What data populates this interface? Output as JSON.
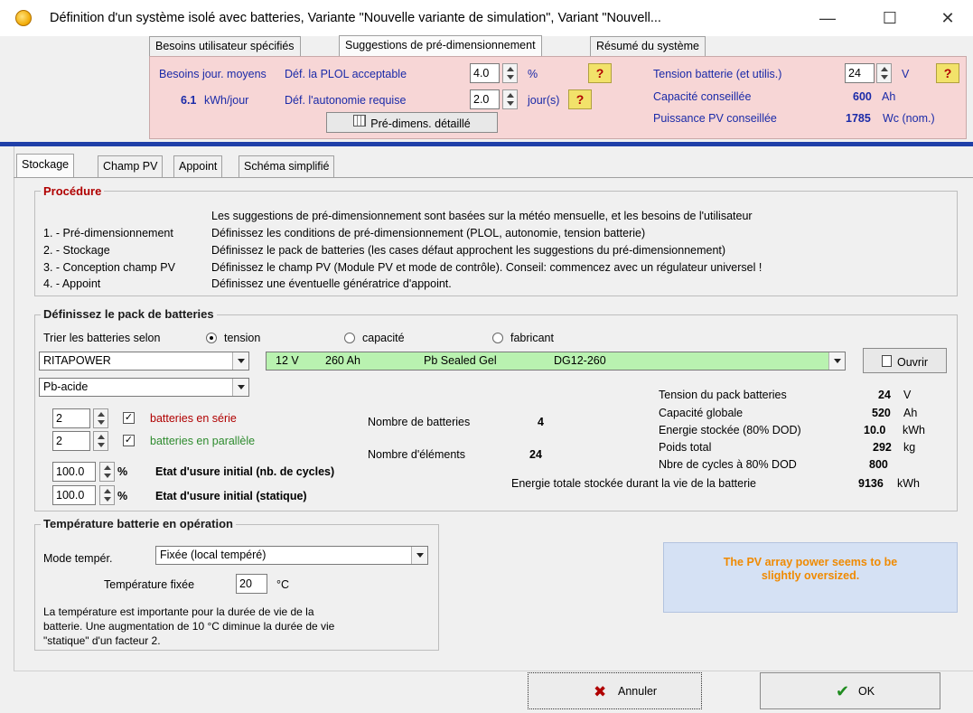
{
  "window": {
    "title": "Définition d'un système isolé avec batteries, Variante  \"Nouvelle variante de simulation\", Variant  \"Nouvell...",
    "minimize": "—",
    "maximize": "☐",
    "close": "✕"
  },
  "top_tabs": [
    "Besoins utilisateur spécifiés",
    "Suggestions de pré-dimensionnement",
    "Résumé du système"
  ],
  "presizing": {
    "needs_label": "Besoins jour. moyens",
    "needs_value": "6.1",
    "needs_unit": "kWh/jour",
    "plol_label": "Déf. la PLOL acceptable",
    "plol_value": "4.0",
    "plol_unit": "%",
    "autonomy_label": "Déf. l'autonomie requise",
    "autonomy_value": "2.0",
    "autonomy_unit": "jour(s)",
    "help": "?",
    "detail_button": "Pré-dimens. détaillé",
    "voltage_label": "Tension batterie (et utilis.)",
    "voltage_value": "24",
    "voltage_unit": "V",
    "capacity_label": "Capacité conseillée",
    "capacity_value": "600",
    "capacity_unit": "Ah",
    "pv_label": "Puissance PV conseillée",
    "pv_value": "1785",
    "pv_unit": "Wc (nom.)"
  },
  "sub_tabs": [
    "Stockage",
    "Champ PV",
    "Appoint",
    "Schéma simplifié"
  ],
  "procedure": {
    "title": "Procédure",
    "intro": "Les suggestions de pré-dimensionnement sont basées sur la météo mensuelle, et les besoins de l'utilisateur",
    "steps": [
      {
        "label": "1. - Pré-dimensionnement",
        "text": "Définissez les conditions de pré-dimensionnement  (PLOL, autonomie, tension batterie)"
      },
      {
        "label": "2. - Stockage",
        "text": "Définissez le pack de batteries  (les cases défaut approchent les suggestions du  pré-dimensionnement)"
      },
      {
        "label": "3. - Conception champ PV",
        "text": "Définissez le champ PV  (Module PV et mode de contrôle).  Conseil: commencez avec un régulateur universel !"
      },
      {
        "label": "4. - Appoint",
        "text": "Définissez une éventuelle génératrice d'appoint."
      }
    ]
  },
  "battery_pack": {
    "title": "Définissez le pack de batteries",
    "sort_label": "Trier les batteries selon",
    "sort_options": [
      "tension",
      "capacité",
      "fabricant"
    ],
    "manufacturer": "RITAPOWER",
    "battery_model": {
      "voltage": "12 V",
      "capacity": "260 Ah",
      "tech": "Pb  Sealed  Gel",
      "model": "DG12-260"
    },
    "open_button": "Ouvrir",
    "technology": "Pb-acide",
    "series_count": "2",
    "series_label": "batteries en série",
    "parallel_count": "2",
    "parallel_label": "batteries en parallèle",
    "wear_cycles_value": "100.0",
    "wear_cycles_label": "Etat d'usure initial (nb. de cycles)",
    "wear_static_value": "100.0",
    "wear_static_label": "Etat d'usure initial (statique)",
    "percent": "%",
    "nb_batteries_label": "Nombre de batteries",
    "nb_batteries_value": "4",
    "nb_elements_label": "Nombre d'éléments",
    "nb_elements_value": "24",
    "stats": [
      {
        "label": "Tension du pack batteries",
        "value": "24",
        "unit": "V"
      },
      {
        "label": "Capacité globale",
        "value": "520",
        "unit": "Ah"
      },
      {
        "label": "Energie stockée (80% DOD)",
        "value": "10.0",
        "unit": "kWh"
      },
      {
        "label": "Poids total",
        "value": "292",
        "unit": "kg"
      },
      {
        "label": "Nbre de cycles à 80% DOD",
        "value": "800",
        "unit": ""
      }
    ],
    "lifetime_label": "Energie totale stockée durant la vie de la batterie",
    "lifetime_value": "9136",
    "lifetime_unit": "kWh"
  },
  "temperature": {
    "title": "Température batterie en opération",
    "mode_label": "Mode tempér.",
    "mode_value": "Fixée (local tempéré)",
    "fixed_label": "Température fixée",
    "fixed_value": "20",
    "fixed_unit": "°C",
    "note_lines": [
      "La température est importante pour la durée de vie de la",
      "batterie. Une augmentation de 10 °C diminue la durée de vie",
      "\"statique\" d'un facteur 2."
    ]
  },
  "warning": {
    "line1": "The PV array power seems to be",
    "line2": "slightly oversized."
  },
  "buttons": {
    "cancel": "Annuler",
    "ok": "OK"
  },
  "colors": {
    "pink_panel": "#f7d6d6",
    "accent_blue": "#1f3fa8",
    "green_field": "#b9f2b0",
    "warning_text": "#f08a00",
    "warning_bg": "#d5e1f4",
    "label_red": "#b00000",
    "label_green": "#2e8b2e"
  }
}
